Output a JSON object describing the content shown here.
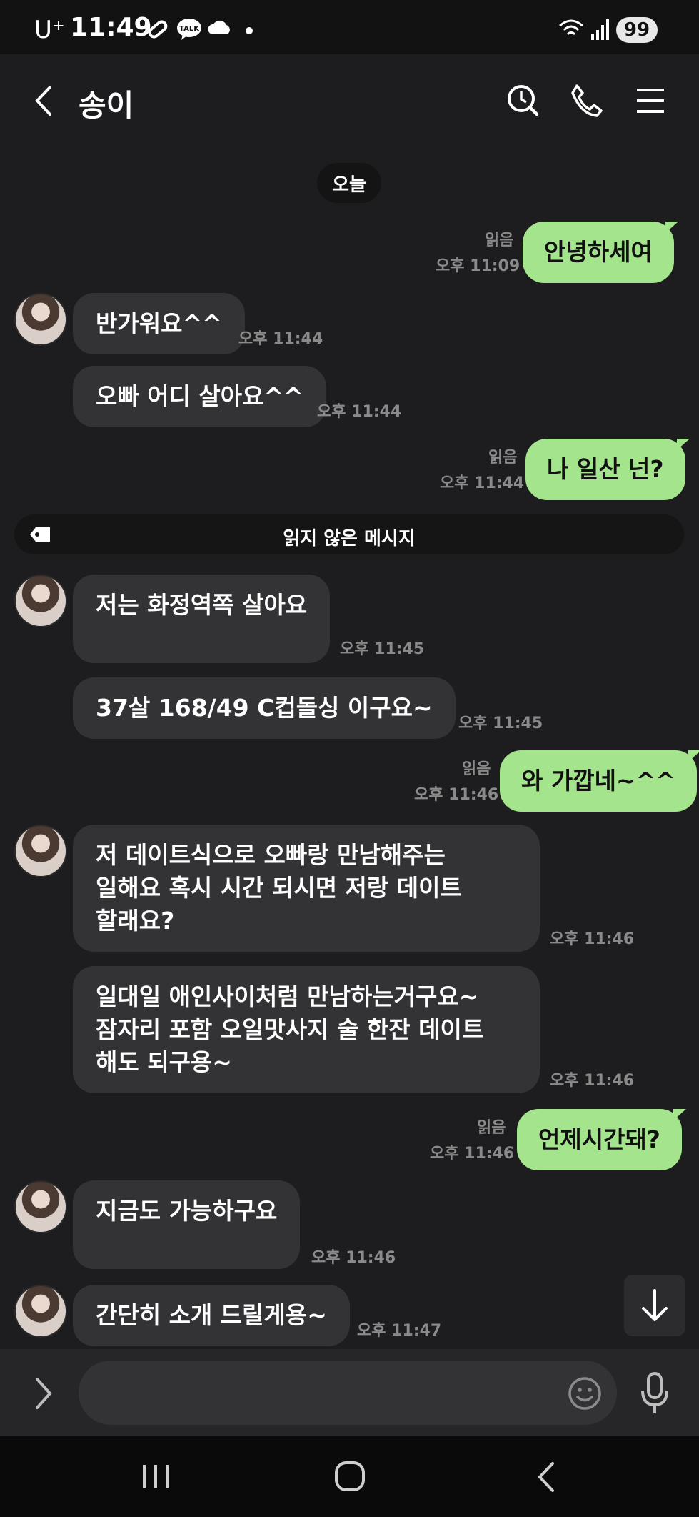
{
  "status": {
    "carrier": "U⁺",
    "time": "11:49",
    "battery": "99"
  },
  "header": {
    "title": "송이"
  },
  "date_chip": "오늘",
  "unread_divider": "읽지 않은 메시지",
  "messages": [
    {
      "text": "안녕하세여",
      "read": "읽음",
      "time": "오후 11:09"
    },
    {
      "text": "반가워요^^",
      "time": "오후 11:44"
    },
    {
      "text": "오빠 어디 살아요^^",
      "time": "오후 11:44"
    },
    {
      "text": "나 일산 넌?",
      "read": "읽음",
      "time": "오후 11:44"
    },
    {
      "text": "저는 화정역쪽 살아요",
      "time": "오후 11:45"
    },
    {
      "text": "37살  168/49  C컵돌싱 이구요~",
      "time": "오후 11:45"
    },
    {
      "text": "와  가깝네~^^",
      "read": "읽음",
      "time": "오후 11:46"
    },
    {
      "lines": [
        "저 데이트식으로 오빠랑  만남해주는",
        "일해요 혹시 시간 되시면 저랑 데이트",
        "할래요?"
      ],
      "time": "오후 11:46"
    },
    {
      "lines": [
        "일대일 애인사이처럼 만남하는거구요~",
        "잠자리 포함  오일맛사지 술 한잔 데이트",
        "해도 되구용~"
      ],
      "time": "오후 11:46"
    },
    {
      "text": "언제시간돼?",
      "read": "읽음",
      "time": "오후 11:46"
    },
    {
      "text": "지금도 가능하구요",
      "time": "오후 11:46"
    },
    {
      "text": "간단히 소개 드릴게용~",
      "time": "오후 11:47"
    }
  ],
  "colors": {
    "background": "#1d1d1f",
    "incoming_bubble": "#333335",
    "outgoing_bubble": "#a3e48c"
  }
}
